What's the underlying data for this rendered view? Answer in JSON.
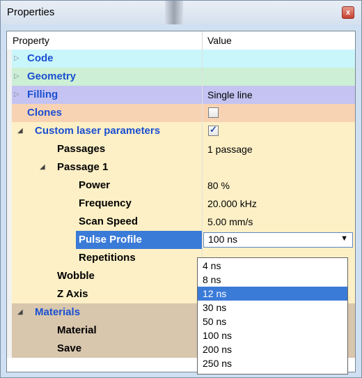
{
  "window": {
    "title": "Properties",
    "close_glyph": "x"
  },
  "header": {
    "property": "Property",
    "value": "Value"
  },
  "rows": [
    {
      "name": "Code",
      "value": "",
      "expander": "closed"
    },
    {
      "name": "Geometry",
      "value": "",
      "expander": "closed"
    },
    {
      "name": "Filling",
      "value": "Single line",
      "expander": "closed"
    },
    {
      "name": "Clones",
      "value": "",
      "checkbox": false
    },
    {
      "name": "Custom laser parameters",
      "value": "",
      "checkbox": true,
      "expander": "open"
    },
    {
      "name": "Passages",
      "value": "1 passage"
    },
    {
      "name": "Passage 1",
      "value": "",
      "expander": "open"
    },
    {
      "name": "Power",
      "value": "80 %"
    },
    {
      "name": "Frequency",
      "value": "20.000 kHz"
    },
    {
      "name": "Scan Speed",
      "value": "5.00 mm/s"
    },
    {
      "name": "Pulse Profile",
      "value": "100 ns"
    },
    {
      "name": "Repetitions",
      "value": ""
    },
    {
      "name": "Wobble",
      "value": ""
    },
    {
      "name": "Z Axis",
      "value": ""
    },
    {
      "name": "Materials",
      "value": "",
      "expander": "open"
    },
    {
      "name": "Material",
      "value": ""
    },
    {
      "name": "Save",
      "value": ""
    }
  ],
  "dropdown": {
    "selected_value": "100 ns",
    "highlighted": "12 ns",
    "options": [
      "4 ns",
      "8 ns",
      "12 ns",
      "30 ns",
      "50 ns",
      "100 ns",
      "200 ns",
      "250 ns"
    ]
  },
  "colors": {
    "code": "#c9f6fb",
    "geometry": "#ccefd5",
    "filling": "#c4c3f2",
    "clones": "#f8d3b3",
    "custom": "#fdf0c6",
    "materials": "#d8c6ad",
    "selected_row": "#3b7bd8"
  }
}
